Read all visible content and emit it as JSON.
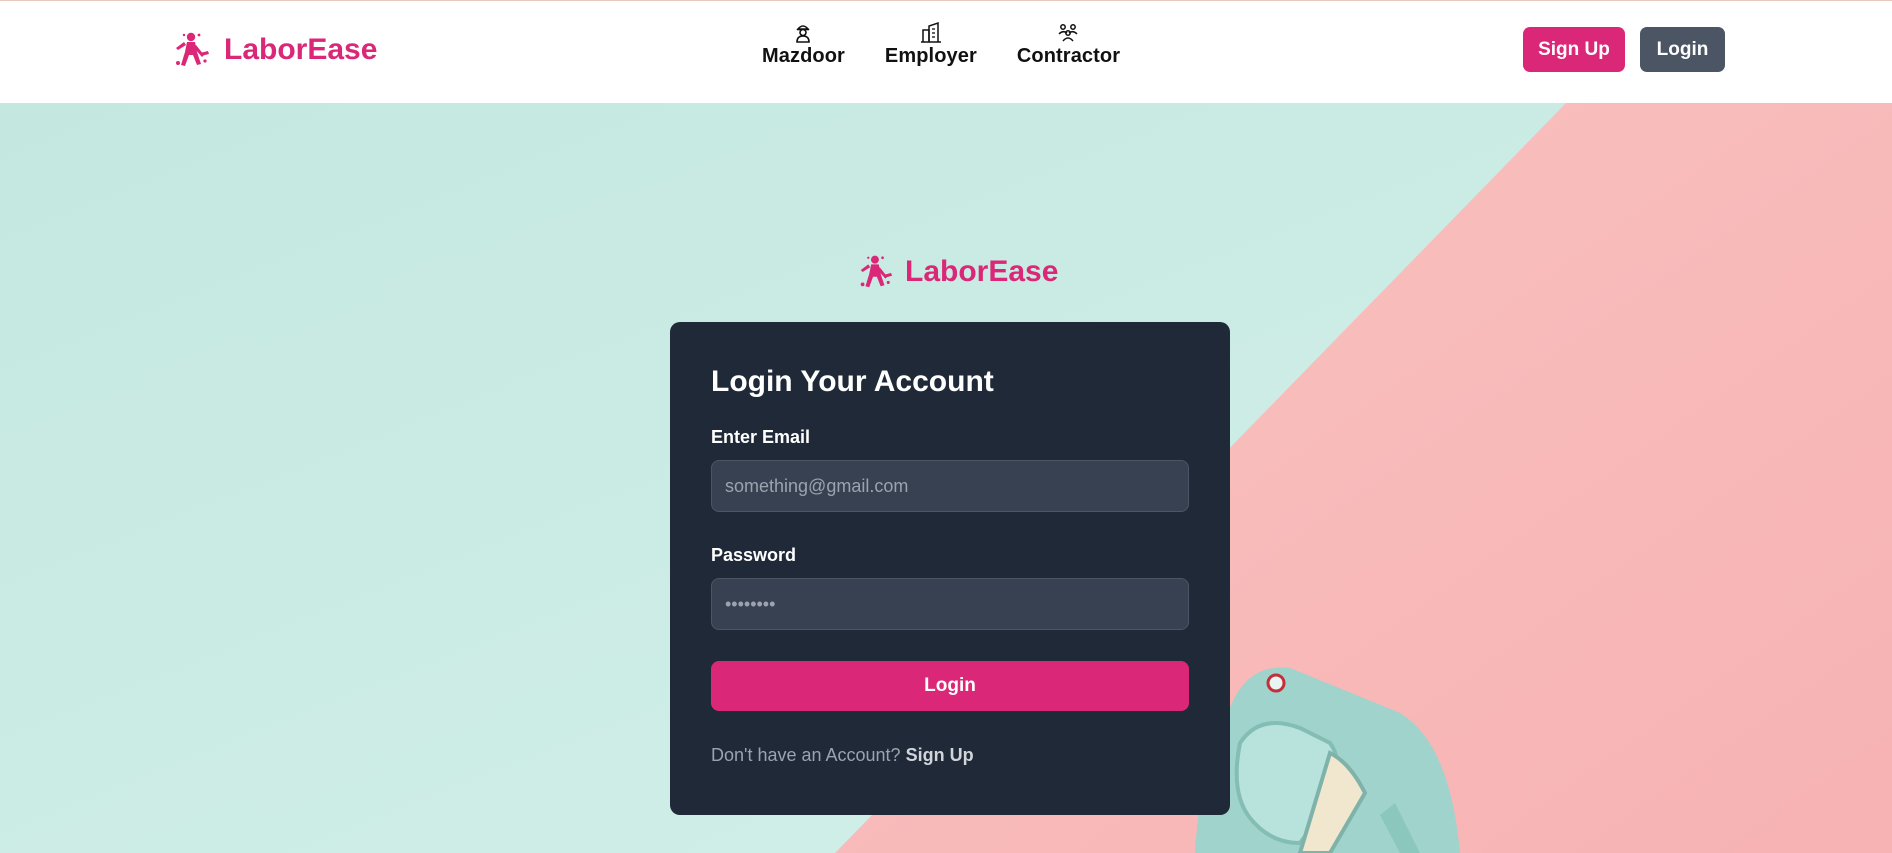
{
  "brand": {
    "name": "LaborEase",
    "logo_icon": "worker-hammer-icon",
    "color": "#db2777"
  },
  "nav": {
    "items": [
      {
        "label": "Mazdoor",
        "icon": "worker-icon"
      },
      {
        "label": "Employer",
        "icon": "building-icon"
      },
      {
        "label": "Contractor",
        "icon": "group-icon"
      }
    ]
  },
  "header_buttons": {
    "signup_label": "Sign Up",
    "login_label": "Login"
  },
  "login_form": {
    "title": "Login Your Account",
    "email_label": "Enter Email",
    "email_placeholder": "something@gmail.com",
    "password_label": "Password",
    "password_value": "••••••••",
    "submit_label": "Login",
    "footer_prompt": "Don't have an Account?",
    "footer_link": "Sign Up"
  },
  "colors": {
    "accent": "#db2777",
    "card_bg": "#1f2937",
    "input_bg": "#374151",
    "secondary_button": "#4b5563",
    "hero_mint": "#c9ebe4",
    "hero_pink": "#f9b9b9"
  }
}
